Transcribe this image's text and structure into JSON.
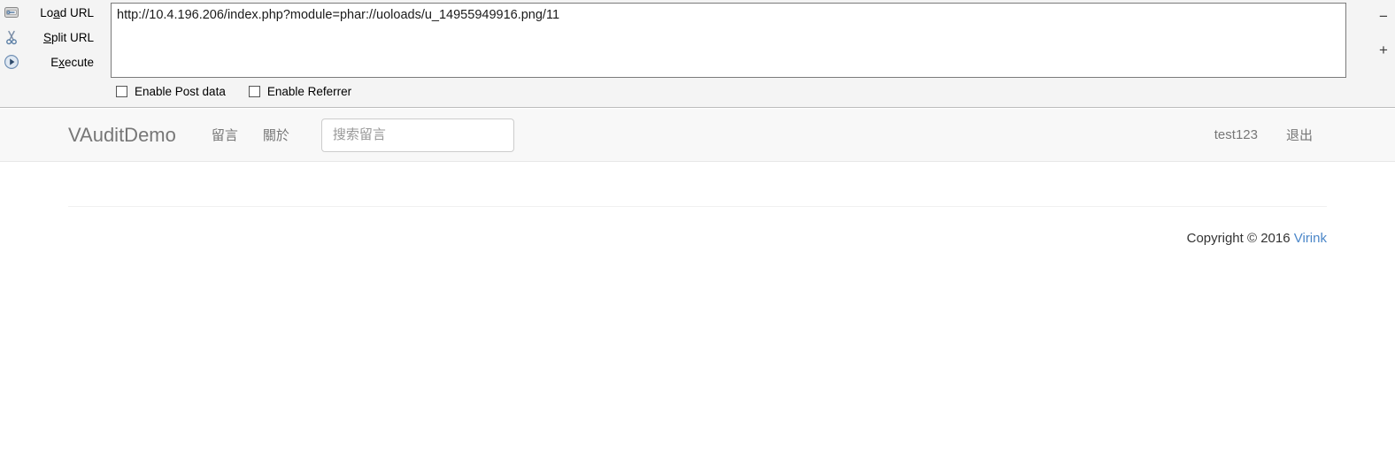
{
  "hackbar": {
    "actions": [
      {
        "icon": "load-url-icon",
        "label_before": "Lo",
        "label_accel": "a",
        "label_after": "d URL",
        "name": "load-url"
      },
      {
        "icon": "scissors-icon",
        "label_before": "",
        "label_accel": "S",
        "label_after": "plit URL",
        "name": "split-url"
      },
      {
        "icon": "execute-icon",
        "label_before": "E",
        "label_accel": "x",
        "label_after": "ecute",
        "name": "execute"
      }
    ],
    "url_value": "http://10.4.196.206/index.php?module=phar://uoloads/u_14955949916.png/11",
    "checkboxes": [
      {
        "label": "Enable Post data",
        "checked": false,
        "name": "enable-post-data"
      },
      {
        "label": "Enable Referrer",
        "checked": false,
        "name": "enable-referrer"
      }
    ],
    "side_buttons": {
      "minus": "−",
      "plus": "+"
    }
  },
  "navbar": {
    "brand": "VAuditDemo",
    "links": [
      {
        "label": "留言",
        "name": "nav-link-messages"
      },
      {
        "label": "關於",
        "name": "nav-link-about"
      }
    ],
    "search": {
      "placeholder": "搜索留言",
      "value": ""
    },
    "right": [
      {
        "label": "test123",
        "name": "nav-user"
      },
      {
        "label": "退出",
        "name": "nav-logout"
      }
    ]
  },
  "footer": {
    "copyright": "Copyright © 2016",
    "link": "Virink"
  },
  "colors": {
    "hackbar_bg": "#f4f4f4",
    "navbar_bg": "#f8f8f8",
    "nav_text": "#777777",
    "link_blue": "#4a86c8",
    "page_bg": "#ffffff"
  }
}
